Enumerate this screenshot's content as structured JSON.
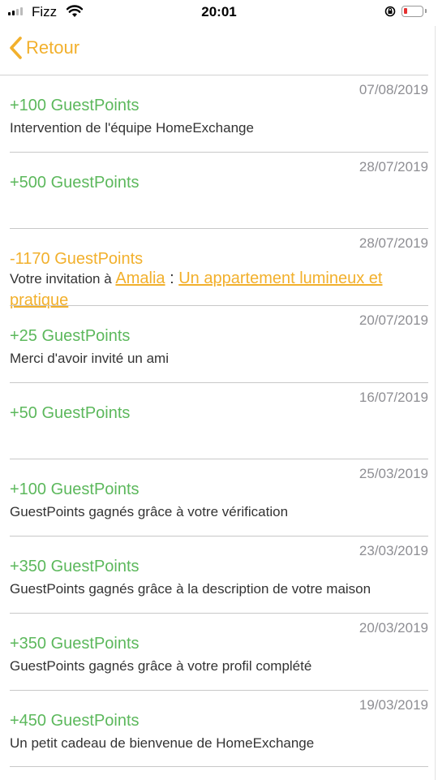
{
  "status_bar": {
    "carrier": "Fizz",
    "time": "20:01"
  },
  "nav": {
    "back_label": "Retour"
  },
  "colors": {
    "accent": "#f2b02c",
    "positive": "#5cb85c",
    "text": "#333333",
    "date": "#8e8e93"
  },
  "transactions": [
    {
      "date": "07/08/2019",
      "points": "+100 GuestPoints",
      "description": "Intervention de l'équipe HomeExchange"
    },
    {
      "date": "28/07/2019",
      "points": "+500 GuestPoints"
    },
    {
      "date": "28/07/2019",
      "points": "-1170 GuestPoints",
      "invitation": {
        "prefix": "Votre invitation à ",
        "host": "Amalia",
        "sep": " : ",
        "home": "Un appartement lumineux et pratique"
      }
    },
    {
      "date": "20/07/2019",
      "points": "+25 GuestPoints",
      "description": "Merci d'avoir invité un ami"
    },
    {
      "date": "16/07/2019",
      "points": "+50 GuestPoints"
    },
    {
      "date": "25/03/2019",
      "points": "+100 GuestPoints",
      "description": "GuestPoints gagnés grâce à votre vérification"
    },
    {
      "date": "23/03/2019",
      "points": "+350 GuestPoints",
      "description": "GuestPoints gagnés grâce à la description de votre maison"
    },
    {
      "date": "20/03/2019",
      "points": "+350 GuestPoints",
      "description": "GuestPoints gagnés grâce à votre profil complété"
    },
    {
      "date": "19/03/2019",
      "points": "+450 GuestPoints",
      "description": "Un petit cadeau de bienvenue de HomeExchange"
    }
  ]
}
